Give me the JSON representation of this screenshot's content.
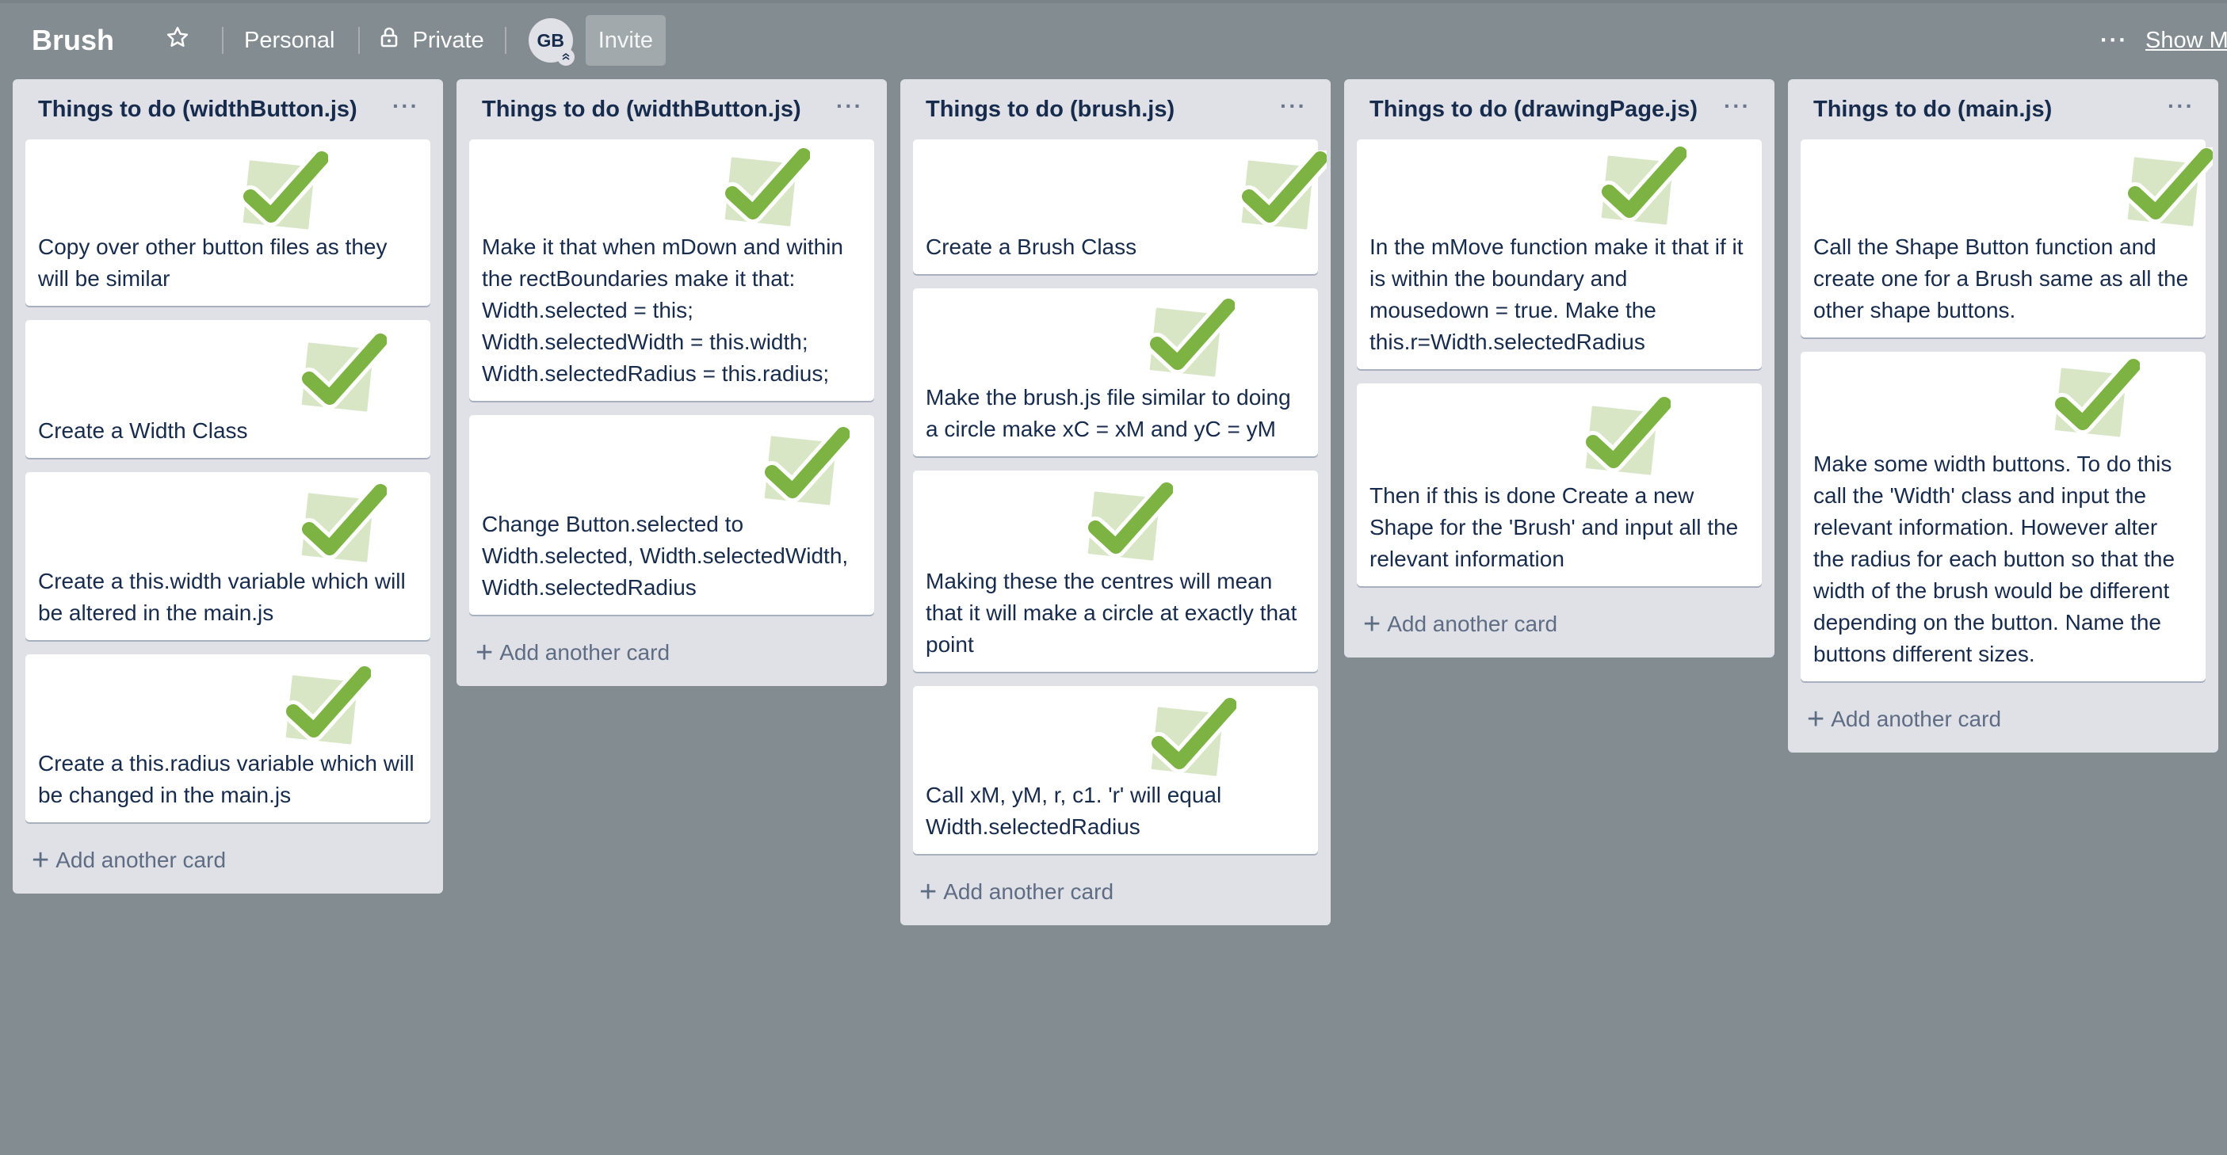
{
  "board": {
    "title": "Brush",
    "visibility_team": "Personal",
    "visibility_privacy": "Private",
    "member_initials": "GB",
    "invite_label": "Invite",
    "show_menu_label": "Show Me"
  },
  "colors": {
    "board_bg": "#838c91",
    "list_bg": "#dfe1e6",
    "card_bg": "#ffffff",
    "check_green": "#7cb342",
    "check_paper": "#d8e6c6"
  },
  "add_card_label": "Add another card",
  "lists": [
    {
      "title": "Things to do (widthButton.js)",
      "cards": [
        "Copy over other button files as they will be similar",
        "Create a Width Class",
        "Create a this.width variable which will be altered in the main.js",
        "Create a this.radius variable which will be changed in the main.js"
      ]
    },
    {
      "title": "Things to do (widthButton.js)",
      "cards": [
        "Make it that when mDown and within the rectBoundaries make it that: Width.selected = this; Width.selectedWidth = this.width; Width.selectedRadius = this.radius;",
        "Change Button.selected to Width.selected, Width.selectedWidth, Width.selectedRadius"
      ]
    },
    {
      "title": "Things to do (brush.js)",
      "cards": [
        "Create a Brush Class",
        "Make the brush.js file similar to doing a circle make xC = xM and yC = yM",
        "Making these the centres will mean that it will make a circle at exactly that point",
        "Call xM, yM, r, c1. 'r' will equal Width.selectedRadius"
      ]
    },
    {
      "title": "Things to do (drawingPage.js)",
      "cards": [
        "In the mMove function make it that if it is within the boundary and mousedown = true. Make the this.r=Width.selectedRadius",
        "Then if this is done Create a new Shape for the 'Brush' and input all the relevant information"
      ]
    },
    {
      "title": "Things to do (main.js)",
      "cards": [
        "Call the Shape Button function and create one for a Brush same as all the other shape buttons.",
        "Make some width buttons. To do this call the 'Width' class and input the relevant information. However alter the radius for each button so that the width of the brush would be different depending on the button. Name the buttons different sizes."
      ]
    }
  ]
}
